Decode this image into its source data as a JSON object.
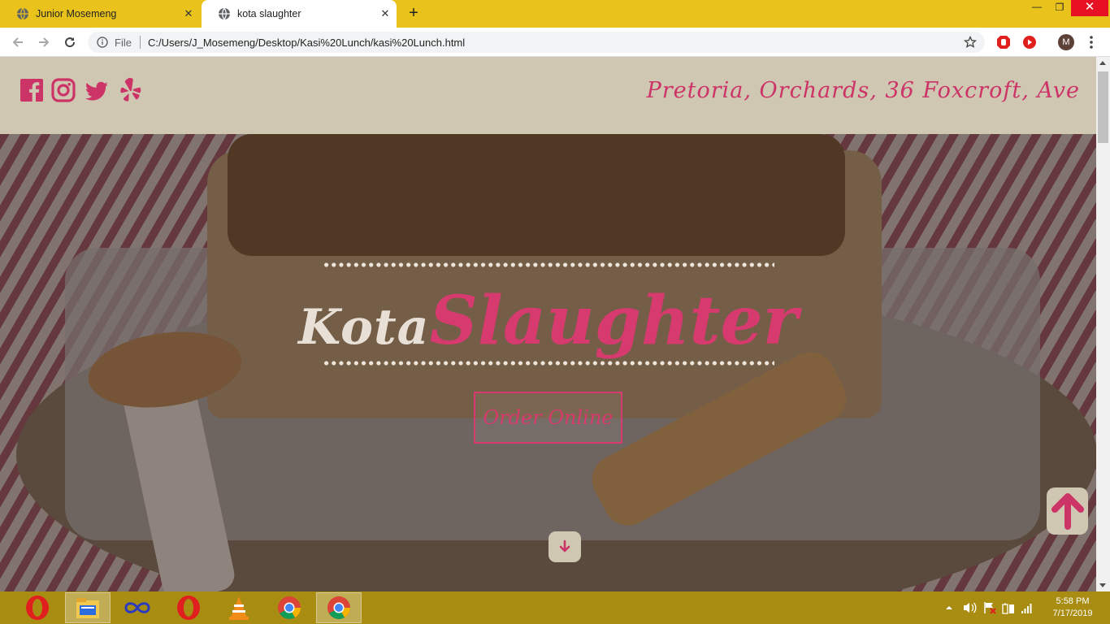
{
  "browser": {
    "tabs": [
      {
        "title": "Junior Mosemeng",
        "active": false
      },
      {
        "title": "kota slaughter",
        "active": true
      }
    ],
    "new_tab_label": "+",
    "scheme_label": "File",
    "url": "C:/Users/J_Mosemeng/Desktop/Kasi%20Lunch/kasi%20Lunch.html",
    "profile_initial": "M",
    "window_controls": {
      "minimize": "—",
      "maximize": "❐",
      "close": "✕"
    },
    "tab_close_glyph": "✕",
    "accent_color": "#e9c31b"
  },
  "page": {
    "header": {
      "social_icons": [
        "facebook-icon",
        "instagram-icon",
        "twitter-icon",
        "yelp-icon"
      ],
      "address": "Pretoria, Orchards, 36 Foxcroft, Ave"
    },
    "hero": {
      "title_part1": "Kota",
      "title_part2": "Slaughter",
      "cta_label": "Order Online"
    },
    "colors": {
      "brand_pink": "#d63a6e",
      "header_bg": "#d0c7b3"
    }
  },
  "taskbar": {
    "apps": [
      "opera-icon",
      "file-explorer-icon",
      "infinity-app-icon",
      "opera-icon",
      "vlc-icon",
      "chrome-icon",
      "chrome-icon"
    ],
    "time": "5:58 PM",
    "date": "7/17/2019",
    "color": "#a88d12"
  }
}
